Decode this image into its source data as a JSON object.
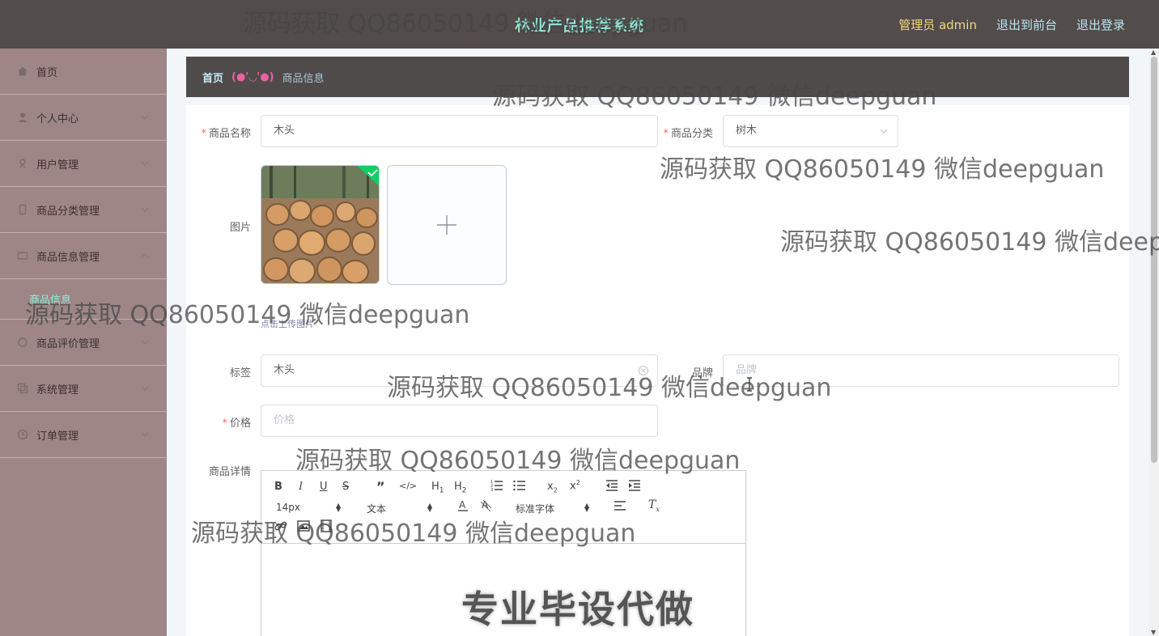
{
  "header": {
    "title": "林业产品推荐系统",
    "admin_label": "管理员 admin",
    "front_link": "退出到前台",
    "logout_link": "退出登录"
  },
  "sidebar": {
    "items": [
      {
        "label": "首页",
        "icon": "home-icon"
      },
      {
        "label": "个人中心",
        "icon": "user-icon"
      },
      {
        "label": "用户管理",
        "icon": "users-icon"
      },
      {
        "label": "商品分类管理",
        "icon": "category-icon"
      },
      {
        "label": "商品信息管理",
        "icon": "goods-icon"
      },
      {
        "label": "商品评价管理",
        "icon": "comment-icon"
      },
      {
        "label": "系统管理",
        "icon": "system-icon"
      },
      {
        "label": "订单管理",
        "icon": "order-icon"
      }
    ],
    "submenu_active": "商品信息"
  },
  "breadcrumb": {
    "home": "首页",
    "separator": "(●'◡'●)",
    "current": "商品信息"
  },
  "form": {
    "name_label": "商品名称",
    "name_value": "木头",
    "category_label": "商品分类",
    "category_value": "树木",
    "image_label": "图片",
    "upload_tip": "点击上传图片",
    "tag_label": "标签",
    "tag_value": "木头",
    "brand_label": "品牌",
    "brand_placeholder": "品牌",
    "price_label": "价格",
    "price_placeholder": "价格",
    "detail_label": "商品详情"
  },
  "editor": {
    "font_size": "14px",
    "paragraph": "文本",
    "font_family": "标准字体",
    "banner_text": "专业毕设代做"
  },
  "watermark": "源码获取 QQ86050149 微信deepguan",
  "colors": {
    "header_bg": "#524c4a",
    "sidebar_bg": "#9e8686",
    "title": "#8fe3d2",
    "admin": "#f2d77f",
    "accent_pink": "#ef5fa3"
  }
}
